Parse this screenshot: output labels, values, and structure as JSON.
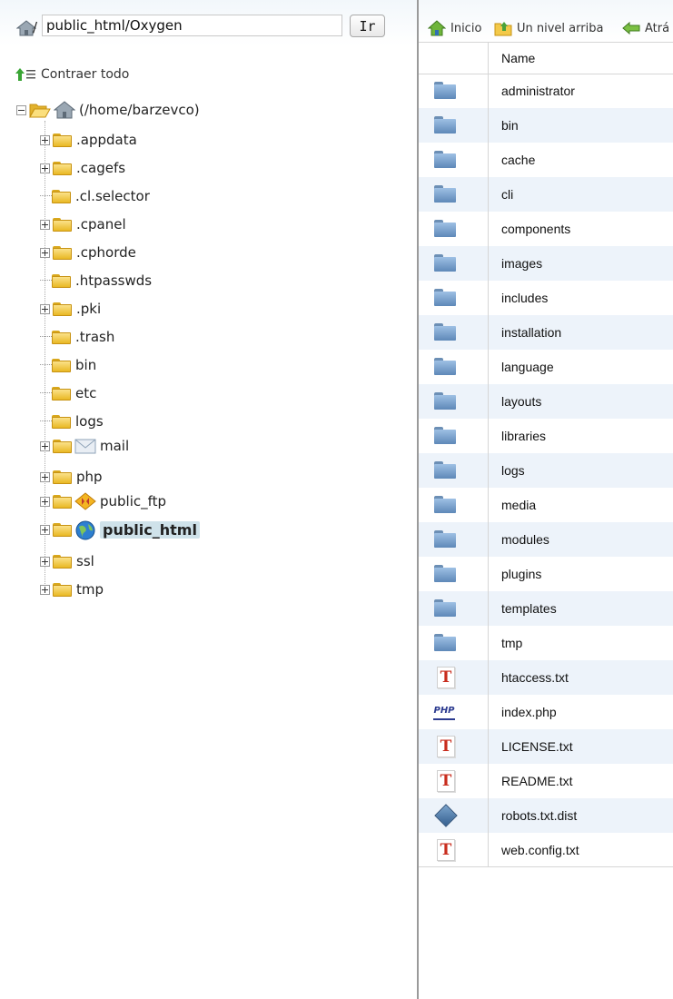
{
  "path_bar": {
    "slash": "/",
    "path_value": "public_html/Oxygen",
    "go_label": "Ir"
  },
  "tree": {
    "collapse_label": "Contraer todo",
    "root_label": "(/home/barzevco)",
    "items": [
      {
        "label": ".appdata",
        "toggle": "plus"
      },
      {
        "label": ".cagefs",
        "toggle": "plus"
      },
      {
        "label": ".cl.selector",
        "toggle": "none"
      },
      {
        "label": ".cpanel",
        "toggle": "plus"
      },
      {
        "label": ".cphorde",
        "toggle": "plus"
      },
      {
        "label": ".htpasswds",
        "toggle": "none"
      },
      {
        "label": ".pki",
        "toggle": "plus"
      },
      {
        "label": ".trash",
        "toggle": "none"
      },
      {
        "label": "bin",
        "toggle": "none"
      },
      {
        "label": "etc",
        "toggle": "none"
      },
      {
        "label": "logs",
        "toggle": "none"
      },
      {
        "label": "mail",
        "toggle": "plus",
        "extra_icon": "mail-icon"
      },
      {
        "label": "php",
        "toggle": "plus"
      },
      {
        "label": "public_ftp",
        "toggle": "plus",
        "extra_icon": "ftp-icon"
      },
      {
        "label": "public_html",
        "toggle": "plus",
        "extra_icon": "globe-icon",
        "selected": true
      },
      {
        "label": "ssl",
        "toggle": "plus"
      },
      {
        "label": "tmp",
        "toggle": "plus"
      }
    ]
  },
  "toolbar": {
    "home_label": "Inicio",
    "up_label": "Un nivel arriba",
    "back_label": "Atrá"
  },
  "file_list": {
    "header_name": "Name",
    "rows": [
      {
        "name": "administrator",
        "icon": "folder-icon"
      },
      {
        "name": "bin",
        "icon": "folder-icon"
      },
      {
        "name": "cache",
        "icon": "folder-icon"
      },
      {
        "name": "cli",
        "icon": "folder-icon"
      },
      {
        "name": "components",
        "icon": "folder-icon"
      },
      {
        "name": "images",
        "icon": "folder-icon"
      },
      {
        "name": "includes",
        "icon": "folder-icon"
      },
      {
        "name": "installation",
        "icon": "folder-icon"
      },
      {
        "name": "language",
        "icon": "folder-icon"
      },
      {
        "name": "layouts",
        "icon": "folder-icon"
      },
      {
        "name": "libraries",
        "icon": "folder-icon"
      },
      {
        "name": "logs",
        "icon": "folder-icon"
      },
      {
        "name": "media",
        "icon": "folder-icon"
      },
      {
        "name": "modules",
        "icon": "folder-icon"
      },
      {
        "name": "plugins",
        "icon": "folder-icon"
      },
      {
        "name": "templates",
        "icon": "folder-icon"
      },
      {
        "name": "tmp",
        "icon": "folder-icon"
      },
      {
        "name": "htaccess.txt",
        "icon": "text-file-icon"
      },
      {
        "name": "index.php",
        "icon": "php-file-icon"
      },
      {
        "name": "LICENSE.txt",
        "icon": "text-file-icon"
      },
      {
        "name": "README.txt",
        "icon": "text-file-icon"
      },
      {
        "name": "robots.txt.dist",
        "icon": "generic-file-icon"
      },
      {
        "name": "web.config.txt",
        "icon": "text-file-icon"
      }
    ]
  }
}
